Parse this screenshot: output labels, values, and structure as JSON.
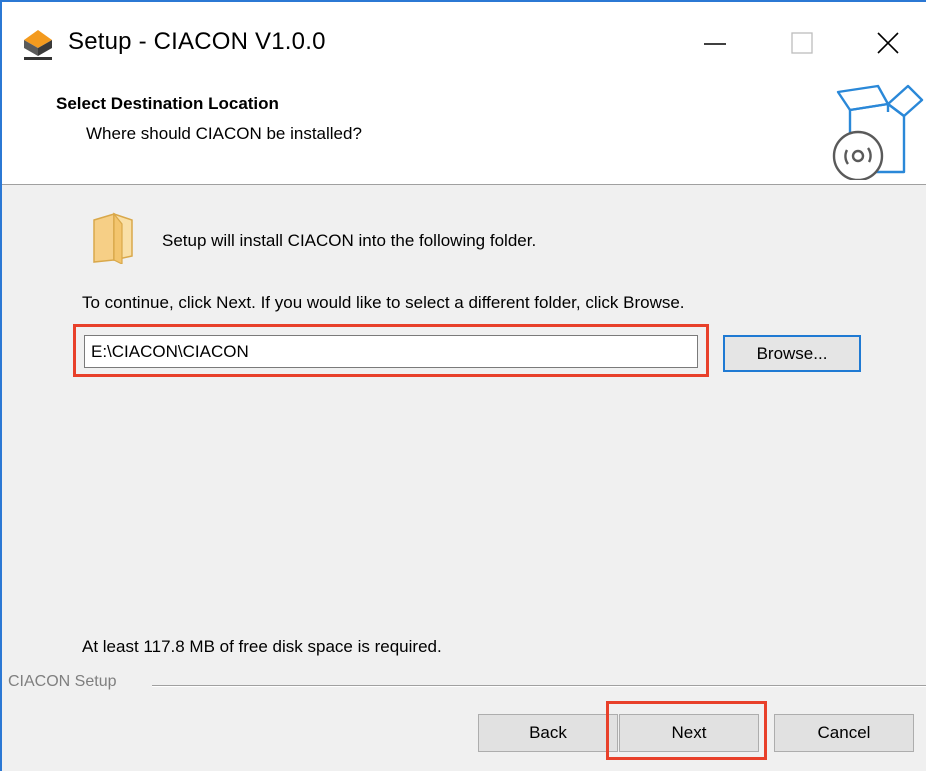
{
  "window": {
    "title": "Setup - CIACON V1.0.0",
    "icons": {
      "app": "ciacon-logo-icon",
      "minimize": "minimize-icon",
      "maximize": "maximize-icon",
      "close": "close-icon"
    }
  },
  "header": {
    "title": "Select Destination Location",
    "subtitle": "Where should CIACON be installed?",
    "icon": "software-box-icon"
  },
  "body": {
    "folder_icon": "folder-icon",
    "install_text": "Setup will install CIACON into the following folder.",
    "continue_text": "To continue, click Next. If you would like to select a different folder, click Browse.",
    "path_value": "E:\\CIACON\\CIACON",
    "browse_label": "Browse...",
    "disk_space_text": "At least 117.8 MB of free disk space is required."
  },
  "footer": {
    "group_label": "CIACON Setup",
    "back_label": "Back",
    "next_label": "Next",
    "cancel_label": "Cancel"
  },
  "colors": {
    "highlight": "#e8402a",
    "window_border": "#2b78d4",
    "browse_border": "#1f7ad3"
  }
}
